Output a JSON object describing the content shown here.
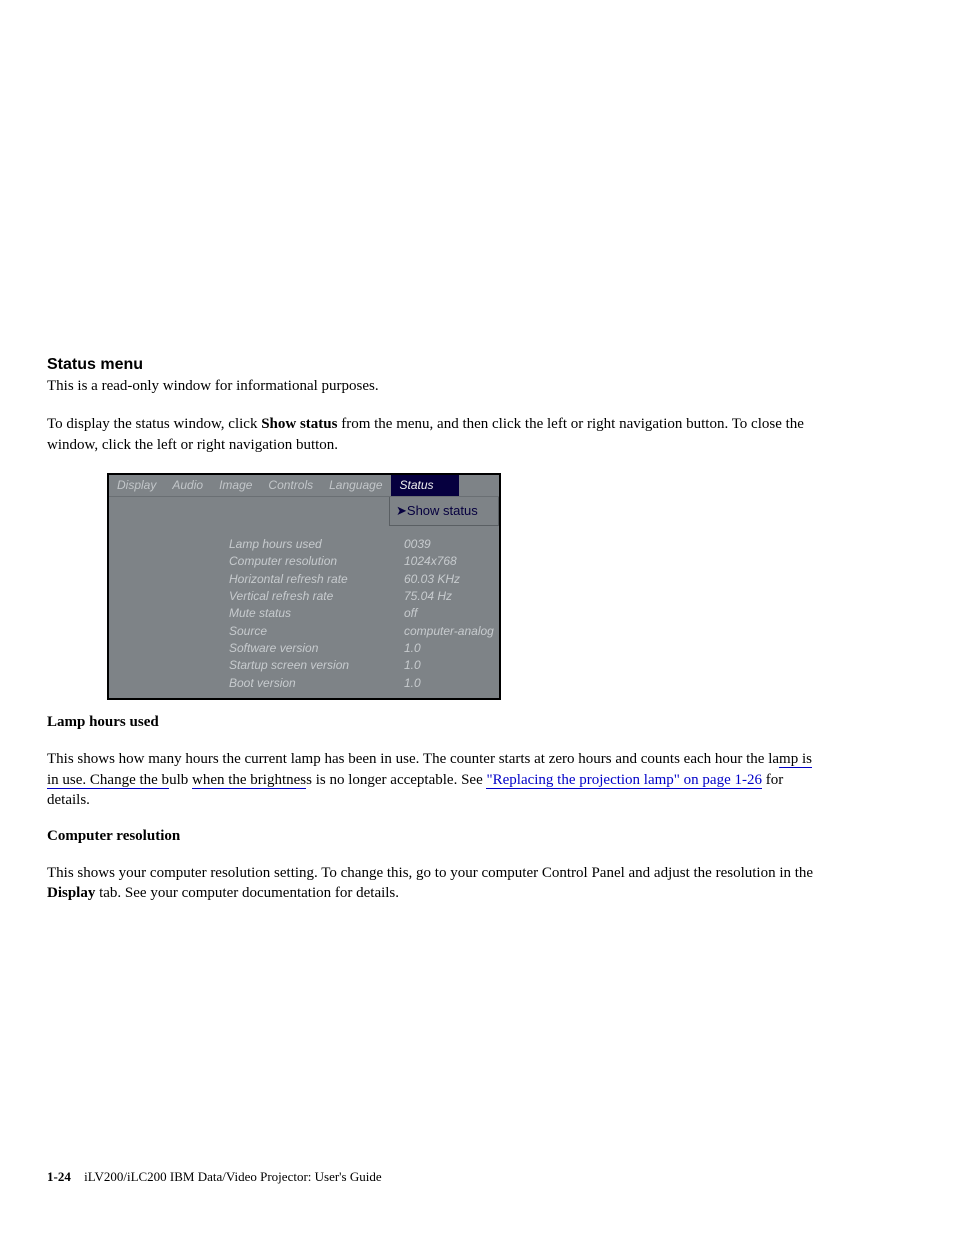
{
  "heading": "Status menu",
  "intro": "This is a read-only window for informational purposes.",
  "howto_pre": "To display the status window, click ",
  "howto_bold": "Show status",
  "howto_post": " from the menu, and then click the left or right navigation button. To close the window, click the left or right navigation button.",
  "menu": {
    "tabs": [
      "Display",
      "Audio",
      "Image",
      "Controls",
      "Language",
      "Status"
    ],
    "active_tab": "Status",
    "submenu": "➤Show status",
    "rows": [
      {
        "label": "Lamp hours used",
        "value": "0039"
      },
      {
        "label": "Computer resolution",
        "value": "1024x768"
      },
      {
        "label": "Horizontal refresh rate",
        "value": "60.03 KHz"
      },
      {
        "label": "Vertical refresh rate",
        "value": "75.04 Hz"
      },
      {
        "label": "Mute status",
        "value": "off"
      },
      {
        "label": "Source",
        "value": "computer-analog"
      },
      {
        "label": "Software version",
        "value": "1.0"
      },
      {
        "label": "Startup screen version",
        "value": "1.0"
      },
      {
        "label": "Boot version",
        "value": "1.0"
      }
    ]
  },
  "sec1_head": "Lamp hours used",
  "sec1_p_a": "This shows how many hours the current lamp has been in use. The counter starts at zero hours and counts each hour the la",
  "sec1_p_b": "mp is in use. Change the b",
  "sec1_p_c": "ulb ",
  "sec1_p_d": "when the brightnes",
  "sec1_p_e": "s is no longer acceptable. See ",
  "sec1_link": "\"Replacing the projection lamp\" on page 1-26",
  "sec1_p_f": " for details.",
  "sec2_head": "Computer resolution",
  "sec2_p_a": "This shows your computer resolution setting. To change this, go to your computer Control Panel and adjust the resolution in the ",
  "sec2_bold": "Display",
  "sec2_p_b": " tab. See your computer documentation for details.",
  "footer_page": "1-24",
  "footer_text": "iLV200/iLC200 IBM Data/Video Projector: User's Guide"
}
